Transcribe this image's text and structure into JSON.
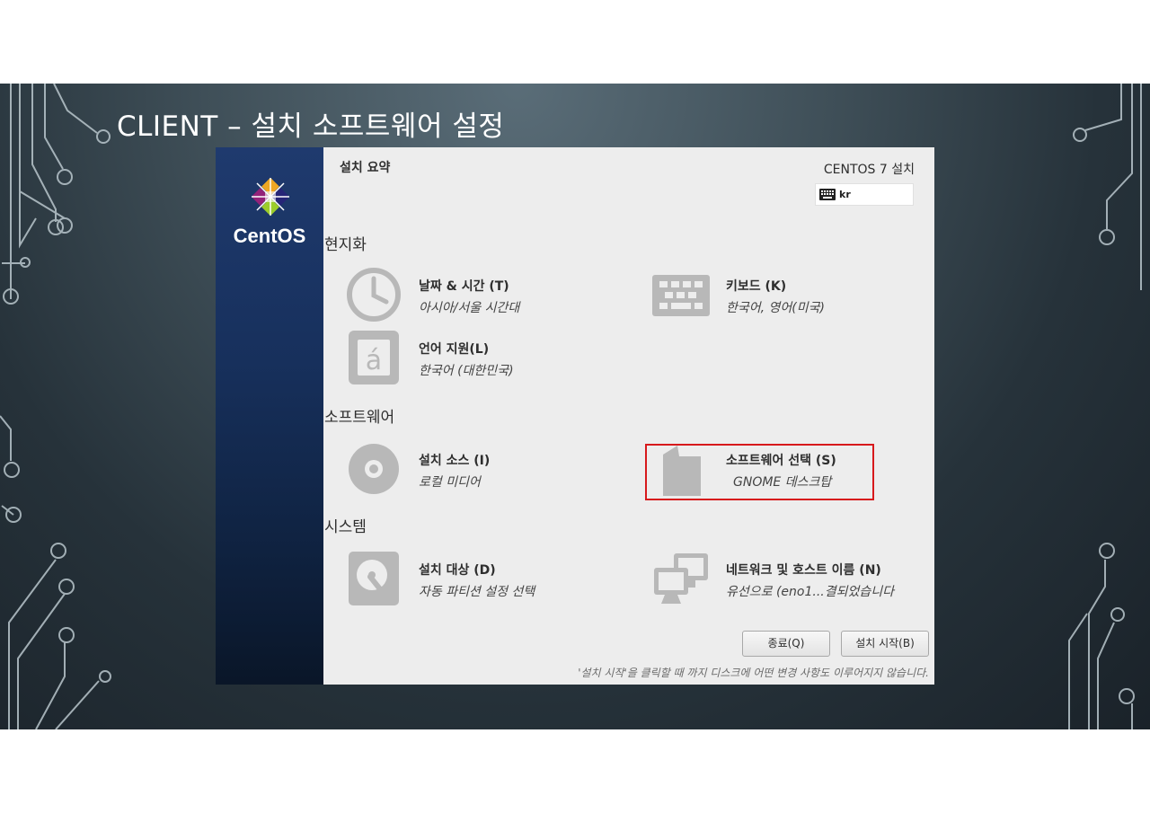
{
  "slide": {
    "title": "CLIENT – 설치 소프트웨어 설정"
  },
  "brand": {
    "name": "CentOS"
  },
  "installer": {
    "header_title": "설치 요약",
    "product_title": "CENTOS 7 설치",
    "keyboard_layout": "kr",
    "sections": {
      "localization": "현지화",
      "software": "소프트웨어",
      "system": "시스템"
    },
    "spokes": {
      "datetime": {
        "title": "날짜 & 시간 (T)",
        "status": "아시아/서울 시간대"
      },
      "keyboard": {
        "title": "키보드 (K)",
        "status": "한국어, 영어(미국)"
      },
      "language": {
        "title": "언어 지원(L)",
        "status": "한국어 (대한민국)"
      },
      "source": {
        "title": "설치 소스 (I)",
        "status": "로컬 미디어"
      },
      "software": {
        "title": "소프트웨어 선택 (S)",
        "status": "GNOME 데스크탑"
      },
      "destination": {
        "title": "설치 대상 (D)",
        "status": "자동 파티션 설정 선택"
      },
      "network": {
        "title": "네트워크 및 호스트 이름 (N)",
        "status": "유선으로 (eno1...결되었습니다"
      }
    },
    "buttons": {
      "quit": "종료(Q)",
      "begin": "설치 시작(B)"
    },
    "footnote": "'설치 시작'을 클릭할 때 까지 디스크에 어떤 변경 사항도 이루어지지 않습니다."
  },
  "colors": {
    "highlight": "#d7191c",
    "icon_gray": "#b8b8b8",
    "sidebar_blue": "#1f3a6e"
  }
}
